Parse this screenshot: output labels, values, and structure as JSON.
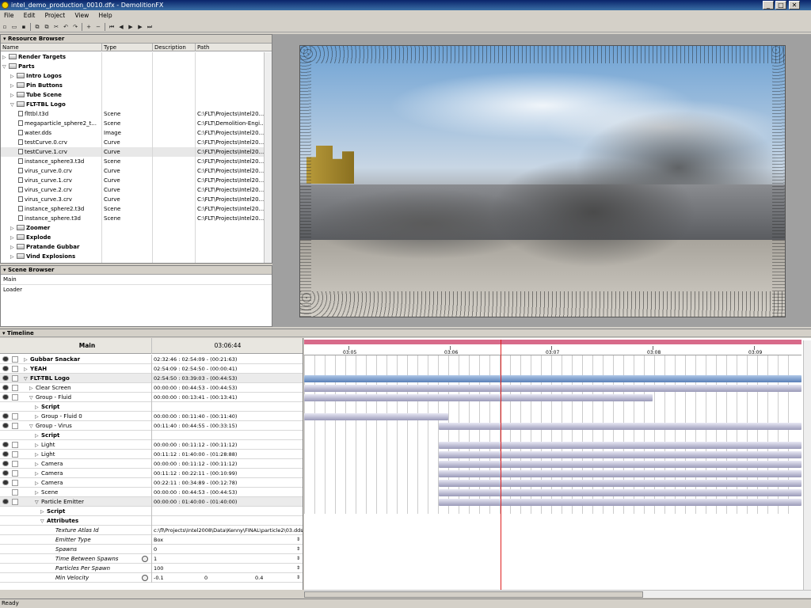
{
  "window": {
    "title": "intel_demo_production_0010.dfx - DemolitionFX",
    "minimize": "_",
    "maximize": "□",
    "close": "✕"
  },
  "menu": [
    "File",
    "Edit",
    "Project",
    "View",
    "Help"
  ],
  "toolbar": {
    "icons": [
      "new-icon",
      "open-icon",
      "save-icon",
      "copy-icon",
      "paste-icon",
      "cut-icon",
      "undo-icon",
      "redo-icon",
      "add-icon",
      "remove-icon",
      "rewind-icon",
      "step-back-icon",
      "play-icon",
      "step-forward-icon",
      "fast-forward-icon"
    ],
    "glyphs": [
      "▫",
      "▭",
      "▪",
      "⧉",
      "⧉",
      "✂",
      "↶",
      "↷",
      "+",
      "−",
      "⏮",
      "◀",
      "▶",
      "▶",
      "⏭"
    ]
  },
  "resource_browser": {
    "title": "Resource Browser",
    "columns": [
      "Name",
      "Type",
      "Description",
      "Path"
    ],
    "rows": [
      {
        "name": "Render Targets",
        "type": "",
        "path": "",
        "kind": "folder",
        "depth": 0,
        "expanded": false
      },
      {
        "name": "Parts",
        "type": "",
        "path": "",
        "kind": "folder",
        "depth": 0,
        "expanded": true
      },
      {
        "name": "Intro Logos",
        "type": "",
        "path": "",
        "kind": "folder",
        "depth": 1,
        "expanded": false
      },
      {
        "name": "Pin Buttons",
        "type": "",
        "path": "",
        "kind": "folder",
        "depth": 1,
        "expanded": false
      },
      {
        "name": "Tube Scene",
        "type": "",
        "path": "",
        "kind": "folder",
        "depth": 1,
        "expanded": false
      },
      {
        "name": "FLT-TBL Logo",
        "type": "",
        "path": "",
        "kind": "folder",
        "depth": 1,
        "expanded": true
      },
      {
        "name": "flttbl.t3d",
        "type": "Scene",
        "path": "C:\\FLT\\Projects\\Intel20...",
        "kind": "file",
        "depth": 2
      },
      {
        "name": "megaparticle_sphere2_t...",
        "type": "Scene",
        "path": "C:\\FLT\\Demolition-Engi...",
        "kind": "file",
        "depth": 2
      },
      {
        "name": "water.dds",
        "type": "Image",
        "path": "C:\\FLT\\Projects\\Intel20...",
        "kind": "file",
        "depth": 2
      },
      {
        "name": "testCurve.0.crv",
        "type": "Curve",
        "path": "C:\\FLT\\Projects\\Intel20...",
        "kind": "file",
        "depth": 2
      },
      {
        "name": "testCurve.1.crv",
        "type": "Curve",
        "path": "C:\\FLT\\Projects\\Intel20...",
        "kind": "file",
        "depth": 2,
        "selected": true
      },
      {
        "name": "instance_sphere3.t3d",
        "type": "Scene",
        "path": "C:\\FLT\\Projects\\Intel20...",
        "kind": "file",
        "depth": 2
      },
      {
        "name": "virus_curve.0.crv",
        "type": "Curve",
        "path": "C:\\FLT\\Projects\\Intel20...",
        "kind": "file",
        "depth": 2
      },
      {
        "name": "virus_curve.1.crv",
        "type": "Curve",
        "path": "C:\\FLT\\Projects\\Intel20...",
        "kind": "file",
        "depth": 2
      },
      {
        "name": "virus_curve.2.crv",
        "type": "Curve",
        "path": "C:\\FLT\\Projects\\Intel20...",
        "kind": "file",
        "depth": 2
      },
      {
        "name": "virus_curve.3.crv",
        "type": "Curve",
        "path": "C:\\FLT\\Projects\\Intel20...",
        "kind": "file",
        "depth": 2
      },
      {
        "name": "instance_sphere2.t3d",
        "type": "Scene",
        "path": "C:\\FLT\\Projects\\Intel20...",
        "kind": "file",
        "depth": 2
      },
      {
        "name": "instance_sphere.t3d",
        "type": "Scene",
        "path": "C:\\FLT\\Projects\\Intel20...",
        "kind": "file",
        "depth": 2
      },
      {
        "name": "Zoomer",
        "type": "",
        "path": "",
        "kind": "folder",
        "depth": 1,
        "expanded": false
      },
      {
        "name": "Explode",
        "type": "",
        "path": "",
        "kind": "folder",
        "depth": 1,
        "expanded": false
      },
      {
        "name": "Pratande Gubbar",
        "type": "",
        "path": "",
        "kind": "folder",
        "depth": 1,
        "expanded": false
      },
      {
        "name": "Vind Explosions",
        "type": "",
        "path": "",
        "kind": "folder",
        "depth": 1,
        "expanded": false
      }
    ]
  },
  "scene_browser": {
    "title": "Scene Browser",
    "items": [
      "Main",
      "Loader"
    ]
  },
  "timeline": {
    "title": "Timeline",
    "header_name": "Main",
    "header_time": "03:06:44",
    "ruler": [
      "03:05",
      "03:06",
      "03:07",
      "03:08",
      "03:09"
    ],
    "rows": [
      {
        "name": "Gubbar Snackar",
        "time": "02:32:46 : 02:54:09 - (00:21:63)",
        "bold": true,
        "indent": 0,
        "eye": true,
        "exp": "▷"
      },
      {
        "name": "YEAH",
        "time": "02:54:09 : 02:54:50 - (00:00:41)",
        "bold": true,
        "indent": 0,
        "eye": true,
        "exp": "▷"
      },
      {
        "name": "FLT-TBL Logo",
        "time": "02:54:50 : 03:39:03 - (00:44:53)",
        "bold": true,
        "indent": 0,
        "eye": true,
        "exp": "▽",
        "gray": true,
        "bar": "blue",
        "bs": 0,
        "be": 1
      },
      {
        "name": "Clear Screen",
        "time": "00:00:00 : 00:44:53 - (00:44:53)",
        "indent": 1,
        "eye": true,
        "exp": "▷",
        "bar": "gray",
        "bs": 0,
        "be": 1
      },
      {
        "name": "Group - Fluid",
        "time": "00:00:00 : 00:13:41 - (00:13:41)",
        "indent": 1,
        "eye": true,
        "exp": "▽",
        "bar": "gray",
        "bs": 0,
        "be": 0.7
      },
      {
        "name": "Script",
        "indent": 2,
        "bold": true,
        "exp": "▷",
        "eye": false
      },
      {
        "name": "Group - Fluid 0",
        "time": "00:00:00 : 00:11:40 - (00:11:40)",
        "indent": 2,
        "eye": true,
        "exp": "▷",
        "bar": "gray",
        "bs": 0,
        "be": 0.29
      },
      {
        "name": "Group - Virus",
        "time": "00:11:40 : 00:44:55 - (00:33:15)",
        "indent": 1,
        "eye": true,
        "exp": "▽",
        "bar": "gray",
        "bs": 0.27,
        "be": 1
      },
      {
        "name": "Script",
        "indent": 2,
        "bold": true,
        "exp": "▷",
        "eye": false
      },
      {
        "name": "Light",
        "time": "00:00:00 : 00:11:12 - (00:11:12)",
        "indent": 2,
        "eye": true,
        "exp": "▷",
        "bar": "gray",
        "bs": 0.27,
        "be": 1
      },
      {
        "name": "Light",
        "time": "00:11:12 : 01:40:00 - (01:28:88)",
        "indent": 2,
        "eye": true,
        "exp": "▷",
        "bar": "gray",
        "bs": 0.27,
        "be": 1
      },
      {
        "name": "Camera",
        "time": "00:00:00 : 00:11:12 - (00:11:12)",
        "indent": 2,
        "eye": true,
        "exp": "▷",
        "bar": "gray",
        "bs": 0.27,
        "be": 1
      },
      {
        "name": "Camera",
        "time": "00:11:12 : 00:22:11 - (00:10:99)",
        "indent": 2,
        "eye": true,
        "exp": "▷",
        "bar": "gray",
        "bs": 0.27,
        "be": 1
      },
      {
        "name": "Camera",
        "time": "00:22:11 : 00:34:89 - (00:12:78)",
        "indent": 2,
        "eye": true,
        "exp": "▷",
        "bar": "gray",
        "bs": 0.27,
        "be": 1
      },
      {
        "name": "Scene",
        "time": "00:00:00 : 00:44:53 - (00:44:53)",
        "indent": 2,
        "eye": false,
        "exp": "▷",
        "bar": "gray",
        "bs": 0.27,
        "be": 1
      },
      {
        "name": "Particle Emitter",
        "time": "00:00:00 : 01:40:00 - (01:40:00)",
        "indent": 2,
        "eye": true,
        "exp": "▽",
        "gray": true,
        "bar": "gray",
        "bs": 0.27,
        "be": 1
      },
      {
        "name": "Script",
        "indent": 3,
        "bold": true,
        "exp": "▷",
        "eye": false
      },
      {
        "name": "Attributes",
        "indent": 3,
        "bold": true,
        "exp": "▽",
        "eye": false
      }
    ],
    "attributes": [
      {
        "label": "Texture Atlas Id",
        "value": "c:\\fl\\Projects\\Intel2008\\Data\\Kenny\\FINAL\\particle2\\03.dds",
        "anim": false,
        "spin": false
      },
      {
        "label": "Emitter Type",
        "value": "Box",
        "anim": false,
        "spin": true
      },
      {
        "label": "Spawns",
        "value": "0",
        "anim": false,
        "spin": true
      },
      {
        "label": "Time Between Spawns",
        "value": "1",
        "anim": true,
        "spin": true
      },
      {
        "label": "Particles Per Spawn",
        "value": "100",
        "anim": false,
        "spin": true
      },
      {
        "label": "Min Velocity",
        "value": "-0.1",
        "value2": "0",
        "value3": "0.4",
        "anim": true,
        "spin": true
      }
    ]
  },
  "status": {
    "text": "Ready"
  }
}
